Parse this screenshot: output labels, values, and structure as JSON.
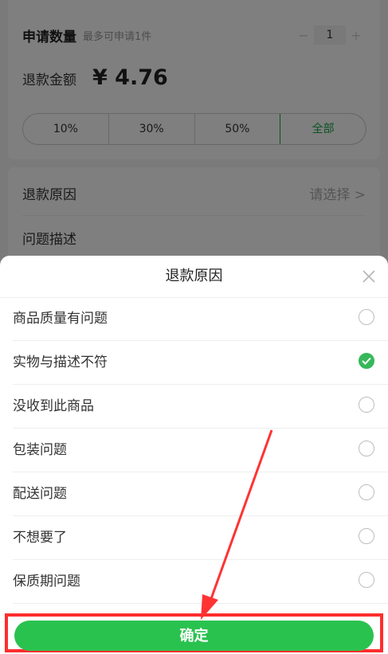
{
  "form": {
    "quantity_label": "申请数量",
    "quantity_hint": "最多可申请1件",
    "stepper_minus": "−",
    "stepper_value": "1",
    "stepper_plus": "+",
    "amount_label": "退款金额",
    "amount_value": "¥ 4.76",
    "percent_options": [
      "10%",
      "30%",
      "50%",
      "全部"
    ],
    "reason_label": "退款原因",
    "reason_placeholder": "请选择 >",
    "description_label": "问题描述"
  },
  "sheet": {
    "title": "退款原因",
    "options": [
      {
        "label": "商品质量有问题",
        "checked": false
      },
      {
        "label": "实物与描述不符",
        "checked": true
      },
      {
        "label": "没收到此商品",
        "checked": false
      },
      {
        "label": "包装问题",
        "checked": false
      },
      {
        "label": "配送问题",
        "checked": false
      },
      {
        "label": "不想要了",
        "checked": false
      },
      {
        "label": "保质期问题",
        "checked": false
      }
    ],
    "confirm_label": "确定"
  },
  "colors": {
    "accent_green": "#2ac24f",
    "highlight_red": "#ff2d2d"
  },
  "icons": [
    "close-icon",
    "check-icon",
    "radio-icon",
    "annotation-arrow"
  ]
}
